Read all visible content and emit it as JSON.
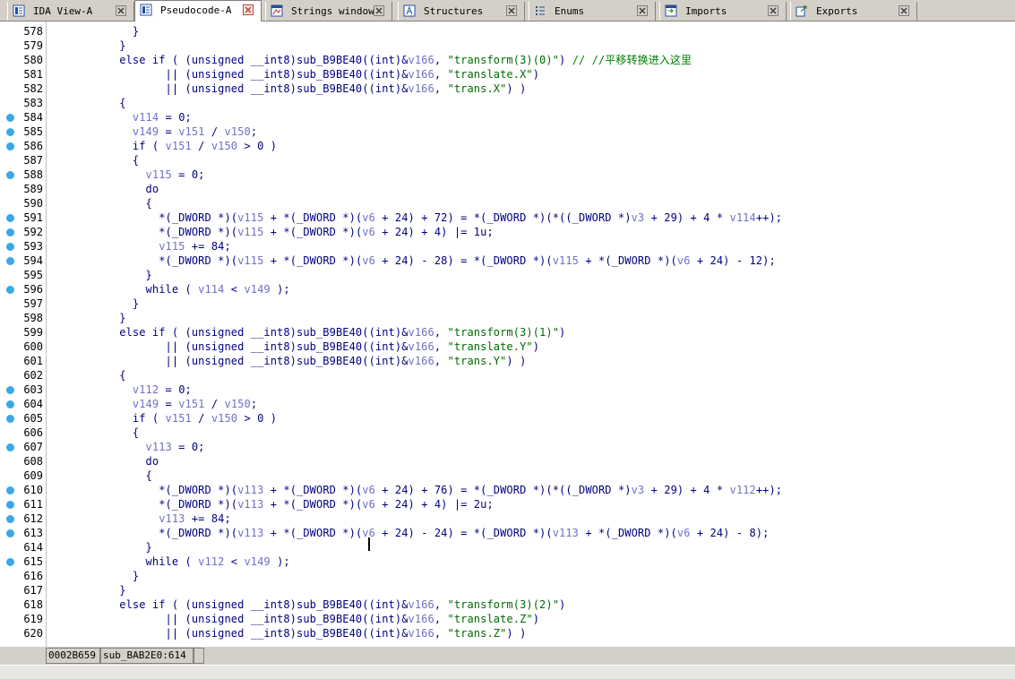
{
  "tabs": [
    {
      "label": "IDA View-A",
      "icon": "ida-view-icon",
      "active": false
    },
    {
      "label": "Pseudocode-A",
      "icon": "pseudocode-icon",
      "active": true
    },
    {
      "label": "Strings window",
      "icon": "strings-icon",
      "active": false
    },
    {
      "label": "Structures",
      "icon": "structures-icon",
      "active": false
    },
    {
      "label": "Enums",
      "icon": "enums-icon",
      "active": false
    },
    {
      "label": "Imports",
      "icon": "imports-icon",
      "active": false
    },
    {
      "label": "Exports",
      "icon": "exports-icon",
      "active": false
    }
  ],
  "colors": {
    "keyword": "#000080",
    "variable": "#7070c8",
    "string": "#006a00",
    "comment": "#008000",
    "breakpoint_dot": "#3aa7e8"
  },
  "code_lines": [
    {
      "n": "578",
      "dot": false,
      "html": "            }"
    },
    {
      "n": "579",
      "dot": false,
      "html": "          }"
    },
    {
      "n": "580",
      "dot": false,
      "html": "          else if ( (unsigned __int8)sub_B9BE40((int)&<v>v166</v>, <s>\"transform(3)(0)\"</s>) <c>// //平移转换进入这里</c>"
    },
    {
      "n": "581",
      "dot": false,
      "html": "                 || (unsigned __int8)sub_B9BE40((int)&<v>v166</v>, <s>\"translate.X\"</s>)"
    },
    {
      "n": "582",
      "dot": false,
      "html": "                 || (unsigned __int8)sub_B9BE40((int)&<v>v166</v>, <s>\"trans.X\"</s>) )"
    },
    {
      "n": "583",
      "dot": false,
      "html": "          {"
    },
    {
      "n": "584",
      "dot": true,
      "html": "            <v>v114</v> = 0;"
    },
    {
      "n": "585",
      "dot": true,
      "html": "            <v>v149</v> = <v>v151</v> / <v>v150</v>;"
    },
    {
      "n": "586",
      "dot": true,
      "html": "            if ( <v>v151</v> / <v>v150</v> > 0 )"
    },
    {
      "n": "587",
      "dot": false,
      "html": "            {"
    },
    {
      "n": "588",
      "dot": true,
      "html": "              <v>v115</v> = 0;"
    },
    {
      "n": "589",
      "dot": false,
      "html": "              do"
    },
    {
      "n": "590",
      "dot": false,
      "html": "              {"
    },
    {
      "n": "591",
      "dot": true,
      "html": "                *(_DWORD *)(<v>v115</v> + *(_DWORD *)(<v>v6</v> + 24) + 72) = *(_DWORD *)(*((_DWORD *)<v>v3</v> + 29) + 4 * <v>v114</v>++);"
    },
    {
      "n": "592",
      "dot": true,
      "html": "                *(_DWORD *)(<v>v115</v> + *(_DWORD *)(<v>v6</v> + 24) + 4) |= 1u;"
    },
    {
      "n": "593",
      "dot": true,
      "html": "                <v>v115</v> += 84;"
    },
    {
      "n": "594",
      "dot": true,
      "html": "                *(_DWORD *)(<v>v115</v> + *(_DWORD *)(<v>v6</v> + 24) - 28) = *(_DWORD *)(<v>v115</v> + *(_DWORD *)(<v>v6</v> + 24) - 12);"
    },
    {
      "n": "595",
      "dot": false,
      "html": "              }"
    },
    {
      "n": "596",
      "dot": true,
      "html": "              while ( <v>v114</v> < <v>v149</v> );"
    },
    {
      "n": "597",
      "dot": false,
      "html": "            }"
    },
    {
      "n": "598",
      "dot": false,
      "html": "          }"
    },
    {
      "n": "599",
      "dot": false,
      "html": "          else if ( (unsigned __int8)sub_B9BE40((int)&<v>v166</v>, <s>\"transform(3)(1)\"</s>)"
    },
    {
      "n": "600",
      "dot": false,
      "html": "                 || (unsigned __int8)sub_B9BE40((int)&<v>v166</v>, <s>\"translate.Y\"</s>)"
    },
    {
      "n": "601",
      "dot": false,
      "html": "                 || (unsigned __int8)sub_B9BE40((int)&<v>v166</v>, <s>\"trans.Y\"</s>) )"
    },
    {
      "n": "602",
      "dot": false,
      "html": "          {"
    },
    {
      "n": "603",
      "dot": true,
      "html": "            <v>v112</v> = 0;"
    },
    {
      "n": "604",
      "dot": true,
      "html": "            <v>v149</v> = <v>v151</v> / <v>v150</v>;"
    },
    {
      "n": "605",
      "dot": true,
      "html": "            if ( <v>v151</v> / <v>v150</v> > 0 )"
    },
    {
      "n": "606",
      "dot": false,
      "html": "            {"
    },
    {
      "n": "607",
      "dot": true,
      "html": "              <v>v113</v> = 0;"
    },
    {
      "n": "608",
      "dot": false,
      "html": "              do"
    },
    {
      "n": "609",
      "dot": false,
      "html": "              {"
    },
    {
      "n": "610",
      "dot": true,
      "html": "                *(_DWORD *)(<v>v113</v> + *(_DWORD *)(<v>v6</v> + 24) + 76) = *(_DWORD *)(*((_DWORD *)<v>v3</v> + 29) + 4 * <v>v112</v>++);"
    },
    {
      "n": "611",
      "dot": true,
      "html": "                *(_DWORD *)(<v>v113</v> + *(_DWORD *)(<v>v6</v> + 24) + 4) |= 2u;"
    },
    {
      "n": "612",
      "dot": true,
      "html": "                <v>v113</v> += 84;"
    },
    {
      "n": "613",
      "dot": true,
      "html": "                *(_DWORD *)(<v>v113</v> + *(_DWORD *)(<v>v6</v> + 24) - 24) = *(_DWORD *)(<v>v113</v> + *(_DWORD *)(<v>v6</v> + 24) - 8);"
    },
    {
      "n": "614",
      "dot": false,
      "html": "              }"
    },
    {
      "n": "615",
      "dot": true,
      "html": "              while ( <v>v112</v> < <v>v149</v> );"
    },
    {
      "n": "616",
      "dot": false,
      "html": "            }"
    },
    {
      "n": "617",
      "dot": false,
      "html": "          }"
    },
    {
      "n": "618",
      "dot": false,
      "html": "          else if ( (unsigned __int8)sub_B9BE40((int)&<v>v166</v>, <s>\"transform(3)(2)\"</s>)"
    },
    {
      "n": "619",
      "dot": false,
      "html": "                 || (unsigned __int8)sub_B9BE40((int)&<v>v166</v>, <s>\"translate.Z\"</s>)"
    },
    {
      "n": "620",
      "dot": false,
      "html": "                 || (unsigned __int8)sub_B9BE40((int)&<v>v166</v>, <s>\"trans.Z\"</s>) )"
    }
  ],
  "status": {
    "address": "0002B659",
    "location": "sub_BAB2E0:614"
  }
}
